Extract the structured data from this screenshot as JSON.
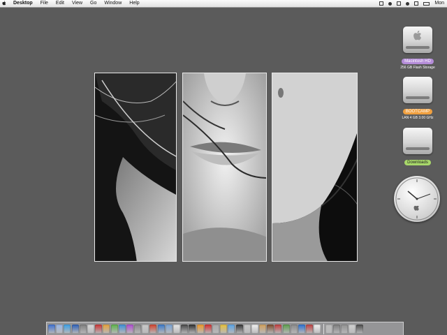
{
  "menubar": {
    "app_name": "Desktop",
    "menus": [
      "File",
      "Edit",
      "View",
      "Go",
      "Window",
      "Help"
    ],
    "clock_text": "Mon"
  },
  "desktop_icons": [
    {
      "label": "Macintosh HD",
      "label_color": "#b48cd8",
      "subtitle": "256 GB Flash Storage"
    },
    {
      "label": "BOOTCAMP",
      "label_color": "#f0a040",
      "subtitle": "LAN 4 GB 3.00 GHz"
    },
    {
      "label": "Downloads",
      "label_color": "#a8d86a",
      "subtitle": ""
    }
  ],
  "dock": {
    "icon_colors": [
      "#3b6fd1",
      "#9ab7e6",
      "#3aa0e6",
      "#2b5fb8",
      "#7d7d7d",
      "#d8d8d8",
      "#c33",
      "#e7a23a",
      "#5bb348",
      "#3a8ed8",
      "#b04ad0",
      "#888",
      "#c8c8c8",
      "#d1412c",
      "#3777c9",
      "#7aa4d6",
      "#e6e6e6",
      "#444",
      "#2d2d2d",
      "#f09a26",
      "#d42d2d",
      "#aaaaaa",
      "#e6c13a",
      "#58a3e6",
      "#333",
      "#c9c9c9",
      "#f0f0f0",
      "#d2a05a",
      "#7a4a2a",
      "#c23c3c",
      "#5a9c4a",
      "#888",
      "#2a6fd0",
      "#c04040",
      "#f2f2f2",
      "#bbbbbb",
      "#7b7b7b",
      "#909090",
      "#d0d0d0",
      "#4a4a4a"
    ]
  }
}
